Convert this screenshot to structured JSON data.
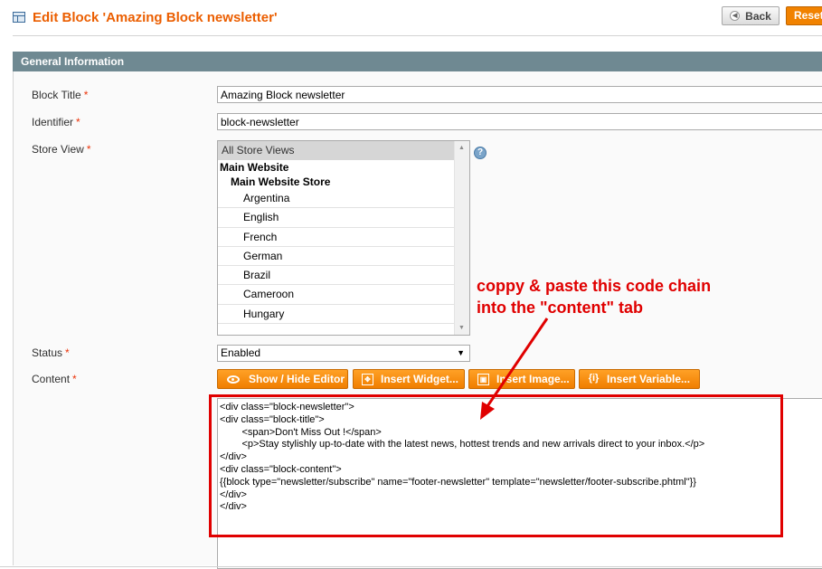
{
  "header": {
    "title": "Edit Block 'Amazing Block newsletter'",
    "back_label": "Back",
    "reset_label": "Reset"
  },
  "fieldset": {
    "title": "General Information"
  },
  "form": {
    "block_title": {
      "label": "Block Title",
      "required": "*",
      "value": "Amazing Block newsletter"
    },
    "identifier": {
      "label": "Identifier",
      "required": "*",
      "value": "block-newsletter"
    },
    "store_view": {
      "label": "Store View",
      "required": "*",
      "selected": "All Store Views",
      "group": "Main Website",
      "subgroup": "Main Website Store",
      "options": [
        "Argentina",
        "English",
        "French",
        "German",
        "Brazil",
        "Cameroon",
        "Hungary"
      ],
      "help_icon": "question-circle-icon"
    },
    "status": {
      "label": "Status",
      "required": "*",
      "value": "Enabled"
    },
    "content": {
      "label": "Content",
      "required": "*",
      "buttons": {
        "show_hide": "Show / Hide Editor",
        "insert_widget": "Insert Widget...",
        "insert_image": "Insert Image...",
        "insert_variable": "Insert Variable..."
      },
      "code": "<div class=\"block-newsletter\">\n<div class=\"block-title\">\n        <span>Don't Miss Out !</span>\n        <p>Stay stylishly up-to-date with the latest news, hottest trends and new arrivals direct to your inbox.</p>\n</div>\n<div class=\"block-content\">\n{{block type=\"newsletter/subscribe\" name=\"footer-newsletter\" template=\"newsletter/footer-subscribe.phtml\"}}\n</div>\n</div>"
    }
  },
  "annotation": {
    "text": "coppy & paste this code chain\ninto the \"content\" tab",
    "color": "#e00000"
  },
  "colors": {
    "accent": "#eb5e00",
    "button": "#f18200",
    "fieldset_header": "#6f8992"
  }
}
